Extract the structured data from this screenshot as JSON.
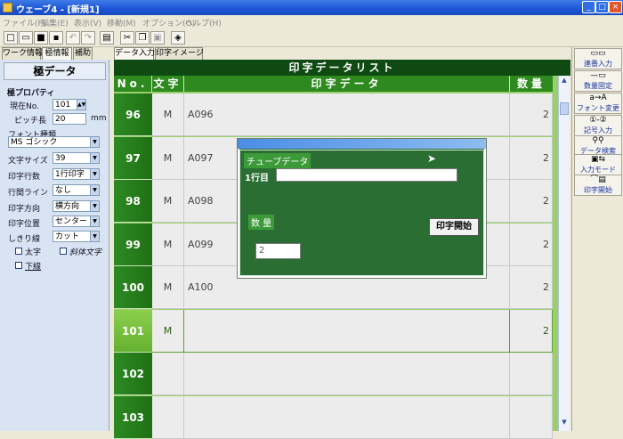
{
  "window": {
    "title": "ウェーブ4 - [新規1]"
  },
  "menu": [
    "ファイル(F)",
    "編集(E)",
    "表示(V)",
    "移動(M)",
    "オプション(O)",
    "ヘルプ(H)"
  ],
  "tabs_left": [
    "ワーク情報",
    "極情報",
    "補助"
  ],
  "tabs_main": [
    "データ入力",
    "印字イメージ"
  ],
  "left_panel": {
    "title": "極データ",
    "section": "極プロパティ",
    "current_no_label": "現在No.",
    "current_no_value": "101",
    "pitch_label": "ピッチ長",
    "pitch_value": "20",
    "pitch_unit": "mm",
    "font_type_label": "フォント種類",
    "font_type_value": "MS ゴシック",
    "char_size_label": "文字サイズ",
    "char_size_value": "39",
    "print_lines_label": "印字行数",
    "print_lines_value": "1行印字",
    "line_spacing_label": "行間ライン",
    "line_spacing_value": "なし",
    "print_dir_label": "印字方向",
    "print_dir_value": "横方向",
    "print_pos_label": "印字位置",
    "print_pos_value": "センター",
    "cut_label": "しきり線",
    "cut_value": "カット",
    "bold_label": "太字",
    "italic_label": "斜体文字",
    "underline_label": "下線"
  },
  "list": {
    "title": "印字データリスト",
    "headers": {
      "no": "No.",
      "char": "文字",
      "data": "印字データ",
      "qty": "数量"
    },
    "rows": [
      {
        "no": "96",
        "char": "M",
        "data": "A096",
        "qty": "2"
      },
      {
        "no": "97",
        "char": "M",
        "data": "A097",
        "qty": "2"
      },
      {
        "no": "98",
        "char": "M",
        "data": "A098",
        "qty": "2"
      },
      {
        "no": "99",
        "char": "M",
        "data": "A099",
        "qty": "2"
      },
      {
        "no": "100",
        "char": "M",
        "data": "A100",
        "qty": "2"
      },
      {
        "no": "101",
        "char": "M",
        "data": "",
        "qty": "2"
      },
      {
        "no": "102",
        "char": "",
        "data": "",
        "qty": ""
      },
      {
        "no": "103",
        "char": "",
        "data": "",
        "qty": ""
      }
    ]
  },
  "dialog": {
    "title": "チューブデータ",
    "line1_label": "1行目",
    "line1_value": "",
    "qty_label": "数 量",
    "qty_value": "2",
    "print_button": "印字開始"
  },
  "right_toolbar": [
    {
      "label": "連番入力",
      "icon": "sequence-icon"
    },
    {
      "label": "数量固定",
      "icon": "fixed-qty-icon"
    },
    {
      "label": "フォント変更",
      "icon": "font-change-icon"
    },
    {
      "label": "記号入力",
      "icon": "symbol-icon"
    },
    {
      "label": "データ検索",
      "icon": "search-icon"
    },
    {
      "label": "入力モード",
      "icon": "input-mode-icon"
    },
    {
      "label": "印字開始",
      "icon": "print-icon"
    }
  ],
  "colors": {
    "accent": "#1f6b2c",
    "selected_row": "#7cc245",
    "titlebar": "#1c55d6"
  }
}
